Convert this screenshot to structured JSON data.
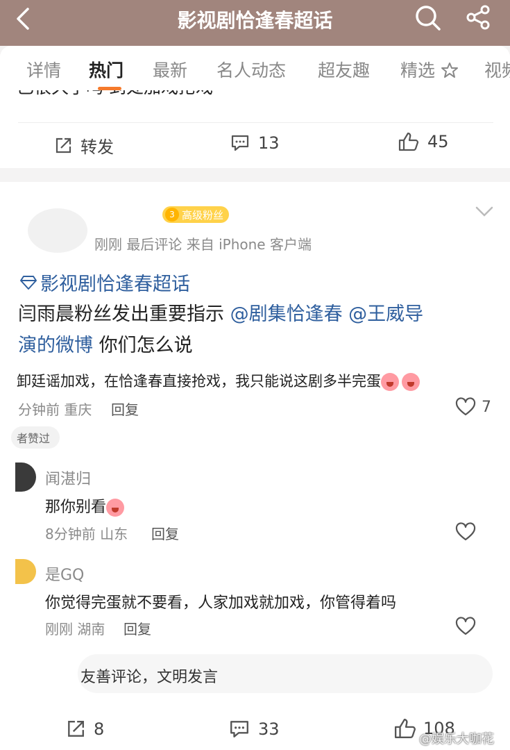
{
  "header": {
    "title": "影视剧恰逢春超话",
    "back_icon": "chevron-left-icon",
    "search_icon": "search-icon",
    "share_icon": "share-icon"
  },
  "tabs": [
    {
      "label": "详情"
    },
    {
      "label": "热门"
    },
    {
      "label": "最新"
    },
    {
      "label": "名人动态"
    },
    {
      "label": "超友趣"
    },
    {
      "label": "精选"
    },
    {
      "label": "视频"
    }
  ],
  "prev_post": {
    "snippet": "已很久了吗  到处加戏抢戏",
    "repost_label": "转发",
    "comments": "13",
    "likes": "45"
  },
  "post": {
    "fan_badge": {
      "level": "3",
      "label": "高级粉丝"
    },
    "meta": "刚刚  最后评论   来自 iPhone 客户端",
    "topic": "影视剧恰逢春超话",
    "text_prefix": "闫雨晨粉丝发出重要指示 ",
    "mention1": "@剧集恰逢春",
    "mention2_a": " @王威导",
    "mention2_b": "演的微博",
    "text_suffix": " 你们怎么说"
  },
  "comment": {
    "text": "卸廷谣加戏，在恰逢春直接抢戏，我只能说这剧多半完蛋",
    "meta": "分钟前  重庆",
    "reply": "回复",
    "likes": "7",
    "liked_by": "者赞过"
  },
  "replies": [
    {
      "name": "闻湛归",
      "text": "那你别看",
      "time": "8分钟前",
      "location": "山东",
      "reply": "回复"
    },
    {
      "name": "是GQ",
      "text": "你觉得完蛋就不要看，人家加戏就加戏，你管得着吗",
      "time": "刚刚",
      "location": "湖南",
      "reply": "回复"
    }
  ],
  "input": {
    "placeholder": "友善评论，文明发言"
  },
  "bottom": {
    "repost": "8",
    "comments": "33",
    "likes": "108"
  },
  "watermark": "@娱乐大咖花",
  "colors": {
    "header": "#a1857d",
    "accent": "#f57a2c",
    "link": "#2f5f9e",
    "badge": "#ffd24a"
  }
}
